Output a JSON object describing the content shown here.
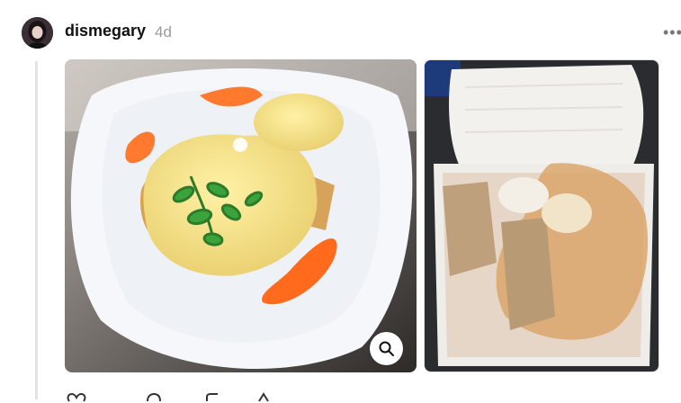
{
  "post": {
    "username": "dismegary",
    "timestamp": "4d"
  },
  "icons": {
    "more": "more-horizontal-icon",
    "zoom": "magnifier-icon",
    "like": "heart-icon",
    "reply": "comment-icon",
    "repost": "repost-icon",
    "share": "share-icon"
  },
  "colors": {
    "username": "#111111",
    "timestamp": "#9a9a9a",
    "thread_line": "#e3e3e3"
  }
}
